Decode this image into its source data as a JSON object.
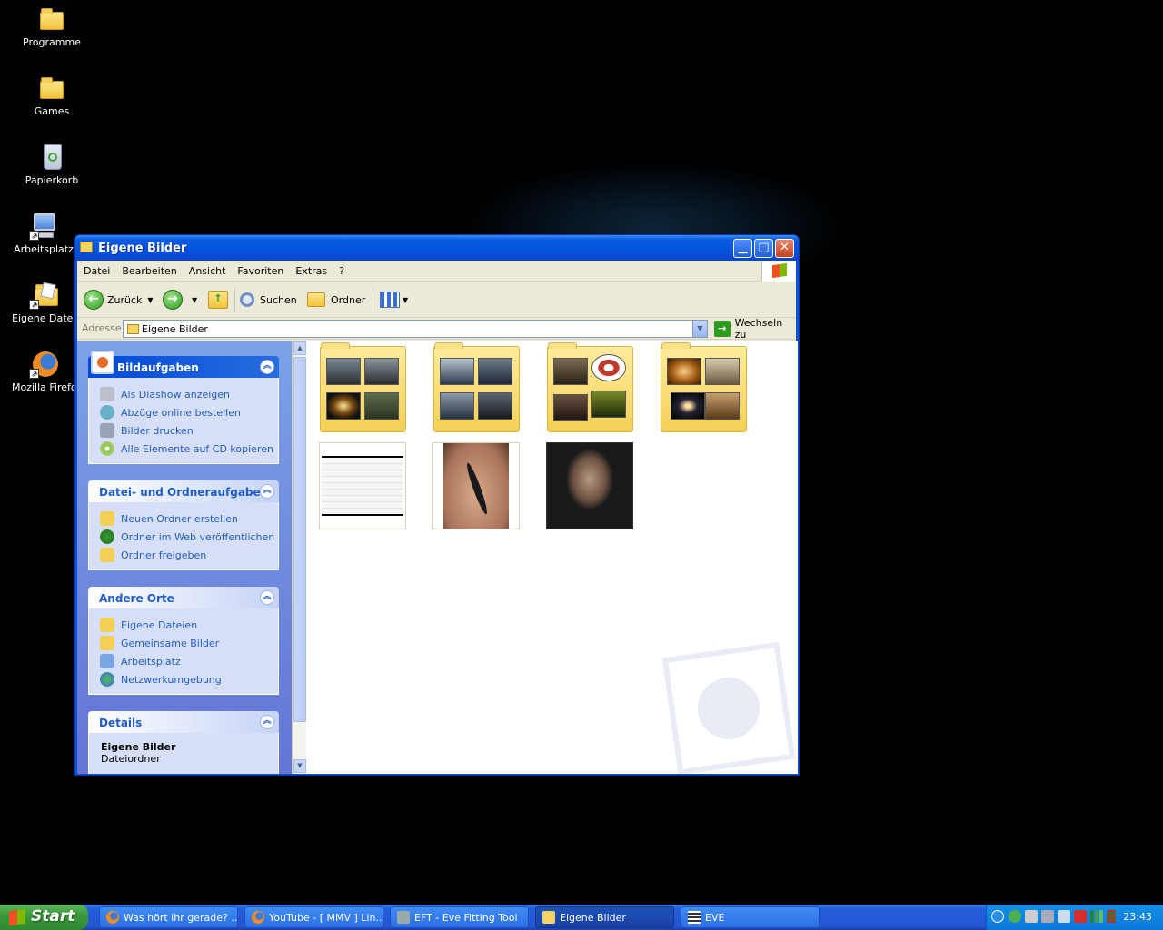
{
  "desktop": {
    "icons": [
      {
        "label": "Programme"
      },
      {
        "label": "Games"
      },
      {
        "label": "Papierkorb"
      },
      {
        "label": "Arbeitsplatz"
      },
      {
        "label": "Eigene Dateien"
      },
      {
        "label": "Mozilla Firefox"
      }
    ]
  },
  "window": {
    "title": "Eigene Bilder",
    "menu": [
      "Datei",
      "Bearbeiten",
      "Ansicht",
      "Favoriten",
      "Extras",
      "?"
    ],
    "toolbar": {
      "back_label": "Zurück",
      "search_label": "Suchen",
      "folders_label": "Ordner"
    },
    "address": {
      "label": "Adresse",
      "value": "Eigene Bilder",
      "go_label": "Wechseln zu"
    },
    "tasks": {
      "bild": {
        "title": "Bildaufgaben",
        "links": [
          "Als Diashow anzeigen",
          "Abzüge online bestellen",
          "Bilder drucken",
          "Alle Elemente auf CD kopieren"
        ]
      },
      "datei": {
        "title": "Datei- und Ordneraufgaben",
        "links": [
          "Neuen Ordner erstellen",
          "Ordner im Web veröffentlichen",
          "Ordner freigeben"
        ]
      },
      "orte": {
        "title": "Andere Orte",
        "links": [
          "Eigene Dateien",
          "Gemeinsame Bilder",
          "Arbeitsplatz",
          "Netzwerkumgebung"
        ]
      },
      "details": {
        "title": "Details",
        "name": "Eigene Bilder",
        "type": "Dateiordner"
      }
    }
  },
  "taskbar": {
    "start_label": "Start",
    "tasks": [
      {
        "label": "Was hört ihr gerade? ...",
        "active": false
      },
      {
        "label": "YouTube - [ MMV ] Lin...",
        "active": false
      },
      {
        "label": "EFT - Eve Fitting Tool",
        "active": false
      },
      {
        "label": "Eigene Bilder",
        "active": true
      },
      {
        "label": "EVE",
        "active": false
      }
    ],
    "clock": "23:43"
  }
}
